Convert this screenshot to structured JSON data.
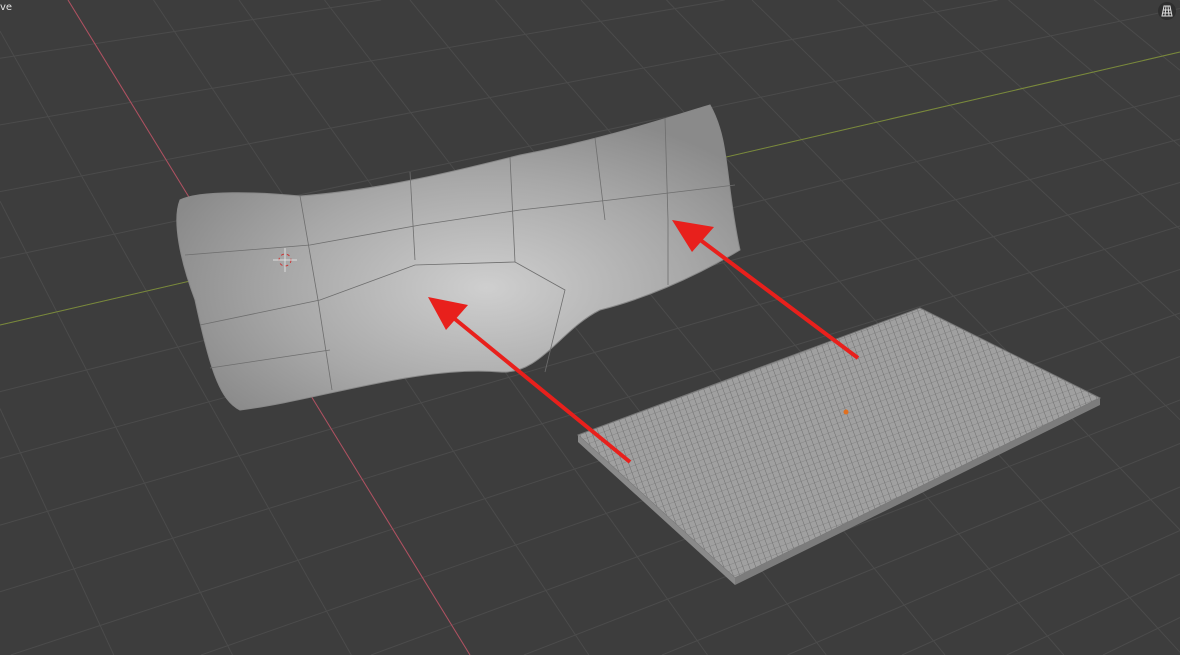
{
  "viewport": {
    "overlay_text": "ve",
    "toggle_icon": "grid-perspective-icon",
    "colors": {
      "background": "#3d3d3d",
      "grid": "#4a4a4a",
      "x_axis": "#b05060",
      "y_axis": "#7a8a3a",
      "arrow": "#e8201c",
      "mesh": "#9a9a9a"
    }
  }
}
